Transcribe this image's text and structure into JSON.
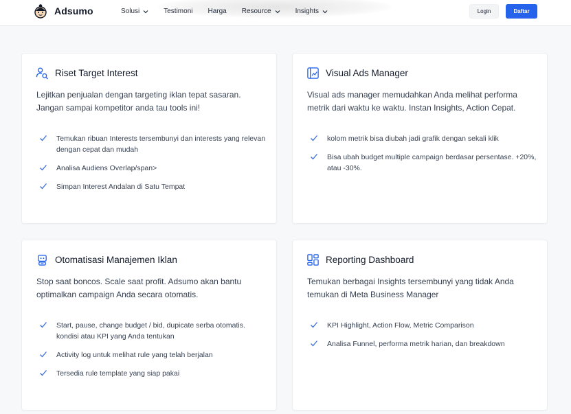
{
  "brand": {
    "name": "Adsumo"
  },
  "nav": [
    {
      "label": "Solusi",
      "dropdown": true
    },
    {
      "label": "Testimoni",
      "dropdown": false
    },
    {
      "label": "Harga",
      "dropdown": false
    },
    {
      "label": "Resource",
      "dropdown": true
    },
    {
      "label": "Insights",
      "dropdown": true
    }
  ],
  "auth": {
    "login_label": "Login",
    "signup_label": "Daftar"
  },
  "colors": {
    "accent": "#2563eb",
    "check": "#3b6fd8"
  },
  "cards": [
    {
      "icon": "user-search-icon",
      "title": "Riset Target Interest",
      "description": "Lejitkan penjualan dengan targeting iklan tepat sasaran. Jangan sampai kompetitor anda tau tools ini!",
      "features": [
        "Temukan ribuan Interests tersembunyi dan interests yang relevan dengan cepat dan mudah",
        "Analisa Audiens Overlap/span>",
        "Simpan Interest Andalan di Satu Tempat"
      ]
    },
    {
      "icon": "chart-panel-icon",
      "title": "Visual Ads Manager",
      "description": "Visual ads manager memudahkan Anda melihat performa metrik dari waktu ke waktu. Instan Insights, Action Cepat.",
      "features": [
        "kolom metrik bisa diubah jadi grafik dengan sekali klik",
        "Bisa ubah budget multiple campaign berdasar persentase. +20%, atau -30%."
      ]
    },
    {
      "icon": "robot-icon",
      "title": "Otomatisasi Manajemen Iklan",
      "description": "Stop saat boncos. Scale saat profit. Adsumo akan bantu optimalkan campaign Anda secara otomatis.",
      "features": [
        "Start, pause, change budget / bid, dupicate serba otomatis. kondisi atau KPI yang Anda tentukan",
        "Activity log untuk melihat rule yang telah berjalan",
        "Tersedia rule template yang siap pakai"
      ]
    },
    {
      "icon": "dashboard-grid-icon",
      "title": "Reporting Dashboard",
      "description": "Temukan berbagai Insights tersembunyi yang tidak Anda temukan di Meta Business Manager",
      "features": [
        "KPI Highlight, Action Flow, Metric Comparison",
        "Analisa Funnel, performa metrik harian, dan breakdown"
      ]
    }
  ]
}
